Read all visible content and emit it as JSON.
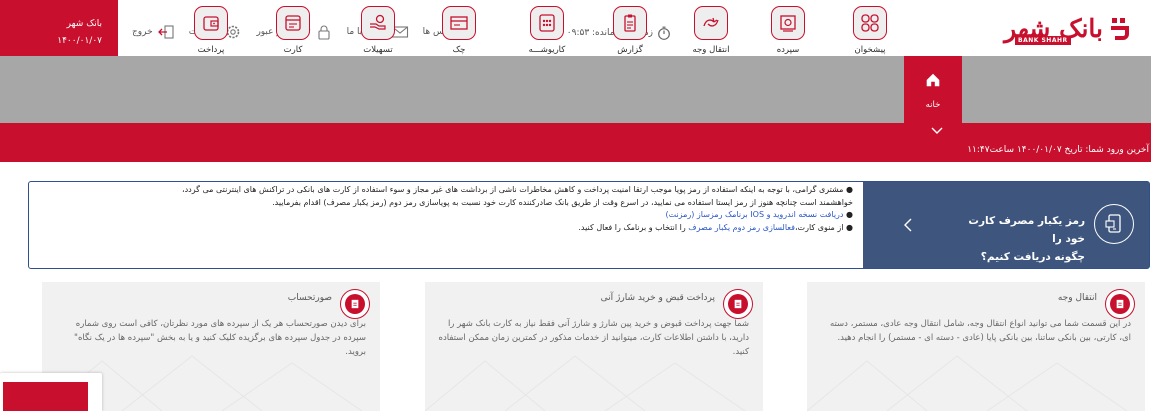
{
  "header": {
    "logo_fa": "بانک شهر",
    "logo_en": "BANK SHAHR",
    "timer_label": "زمان باقی‌مانده: ۰۹:۵۳",
    "links": [
      {
        "label": "تماس ها",
        "icon": "headset-icon"
      },
      {
        "label": "تماس با ما",
        "icon": "envelope-icon"
      },
      {
        "label": "تغییر رمز عبور",
        "icon": "lock-icon"
      },
      {
        "label": "تنظیمات",
        "icon": "gear-icon"
      },
      {
        "label": "خروج",
        "icon": "logout-icon"
      }
    ],
    "branch_name": "بانک شهر",
    "date": "۱۴۰۰/۰۱/۰۷"
  },
  "nav": {
    "home": "خانه",
    "items": [
      "پیشخوان",
      "سپرده",
      "انتقال وجه",
      "گزارش",
      "کاریوشـــه",
      "چک",
      "تسهیلات",
      "کارت",
      "پرداخت"
    ]
  },
  "last_login": "آخرین ورود شما: تاریخ ۱۴۰۰/۰۱/۰۷ ساعت۱۱:۴۷",
  "notice": {
    "title_line1": "رمز یکبار مصرف کارت خود را",
    "title_line2": "چگونه دریافت کنیم؟",
    "p1": "مشتری گرامی، با توجه به اینکه استفاده از رمز پویا موجب ارتقا امنیت پرداخت و کاهش مخاطرات ناشی از برداشت های غیر مجاز و سوء استفاده از کارت های بانکی در تراکنش های اینترنتی می گردد،",
    "p2": "خواهشمند است چنانچه هنوز از رمز ایستا استفاده می نمایید، در اسرع وقت از طریق بانک صادرکننده کارت خود نسبت به پویاسازی رمز دوم (رمز یکبار مصرف) اقدام بفرمایید.",
    "p3_link": "دریافت نسخه اندروید و IOS برنامک رمزساز (رمزنت)",
    "p4_pre": "از منوی کارت،",
    "p4_link": "فعالسازی رمز دوم یکبار مصرف",
    "p4_post": "را انتخاب و برنامک را فعال کنید."
  },
  "cards": [
    {
      "title": "انتقال وجه",
      "text": "در این قسمت شما می توانید انواع انتقال وجه، شامل انتقال وجه عادی، مستمر، دسته ای، کارتی، بین بانکی ساتنا، بین بانکی پایا (عادی - دسته ای - مستمر) را انجام دهید."
    },
    {
      "title": "پرداخت قبض و خرید شارژ آنی",
      "text": "شما جهت پرداخت قبوض و خرید پین شارژ و شارژ آنی فقط نیاز به کارت بانک شهر را دارید، با داشتن اطلاعات کارت، میتوانید از خدمات مذکور در کمترین زمان ممکن استفاده کنید."
    },
    {
      "title": "صورتحساب",
      "text": "برای دیدن صورتحساب هر یک از سپرده های مورد نظرتان، کافی است روی شماره سپرده در جدول سپرده های برگزیده کلیک کنید و یا به بخش \"سپرده ها در یک نگاه\" بروید."
    }
  ],
  "colors": {
    "brand": "#c8102e",
    "nav_bg": "#a7a7a7",
    "notice_head": "#3e557e",
    "card_bg": "#f1f1f1"
  }
}
